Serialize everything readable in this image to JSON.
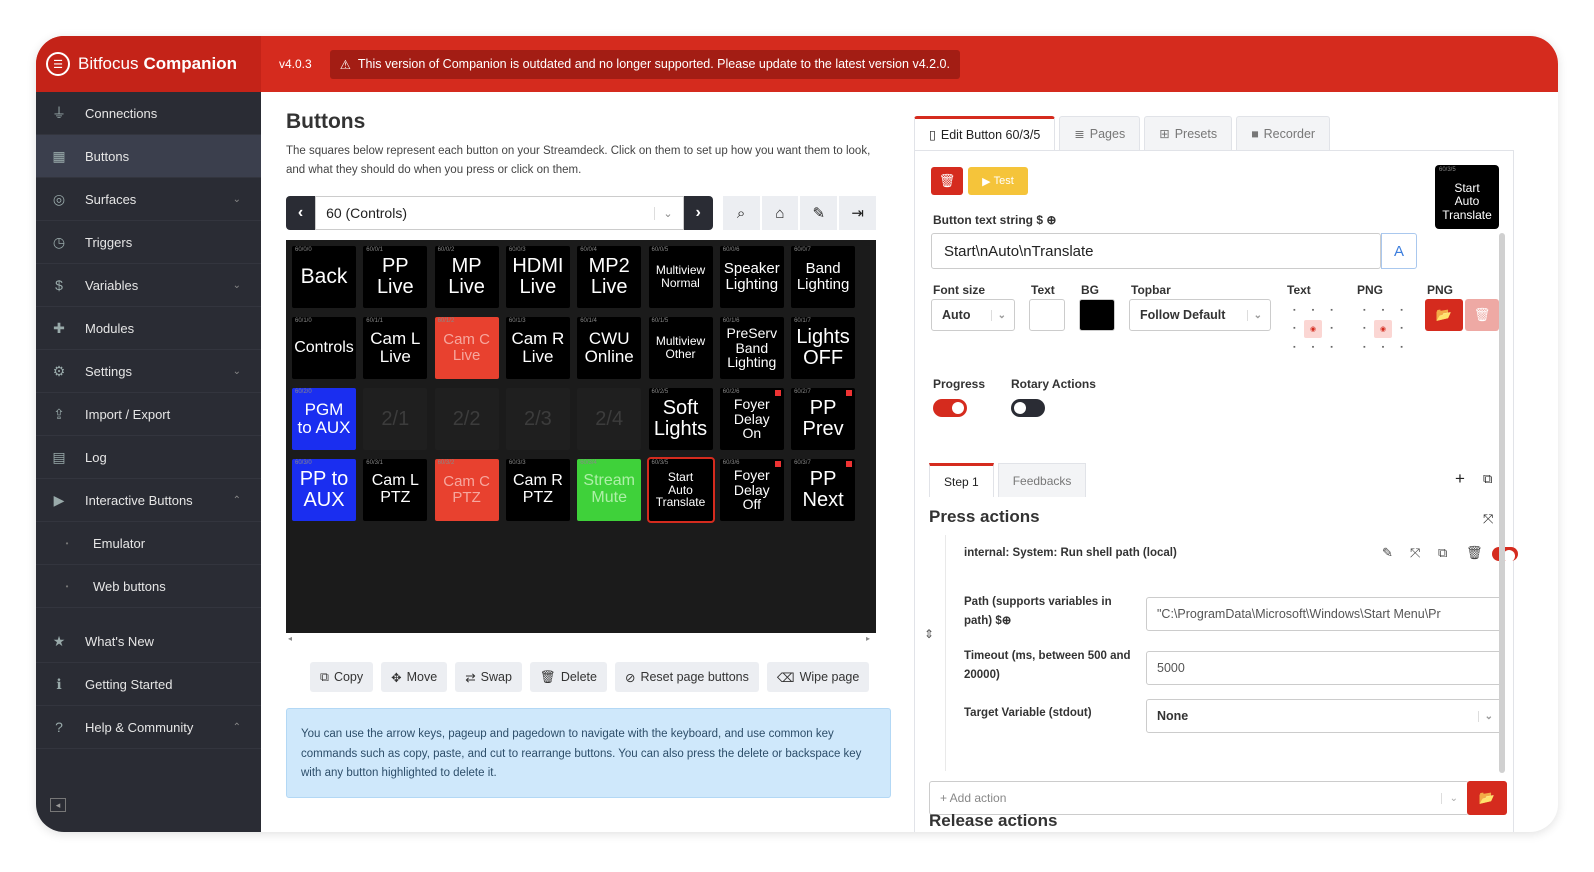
{
  "app": {
    "brand_light": "Bitfocus",
    "brand_bold": "Companion",
    "version": "v4.0.3",
    "alert": "This version of Companion is outdated and no longer supported. Please update to the latest version v4.2.0."
  },
  "sidebar": {
    "items": [
      {
        "label": "Connections",
        "icon": "plug-icon",
        "glyph": "⏚"
      },
      {
        "label": "Buttons",
        "icon": "grid-icon",
        "glyph": "▦"
      },
      {
        "label": "Surfaces",
        "icon": "gamepad-icon",
        "glyph": "◎"
      },
      {
        "label": "Triggers",
        "icon": "clock-icon",
        "glyph": "◷"
      },
      {
        "label": "Variables",
        "icon": "dollar-icon",
        "glyph": "$"
      },
      {
        "label": "Modules",
        "icon": "puzzle-icon",
        "glyph": "✚"
      },
      {
        "label": "Settings",
        "icon": "gear-icon",
        "glyph": "⚙"
      },
      {
        "label": "Import / Export",
        "icon": "file-export-icon",
        "glyph": "⇪"
      },
      {
        "label": "Log",
        "icon": "clipboard-icon",
        "glyph": "▤"
      },
      {
        "label": "Interactive Buttons",
        "icon": "play-square-icon",
        "glyph": "▶"
      },
      {
        "label": "Emulator",
        "icon": "dot-icon",
        "glyph": "•"
      },
      {
        "label": "Web buttons",
        "icon": "dot-icon",
        "glyph": "•"
      },
      {
        "label": "What's New",
        "icon": "star-icon",
        "glyph": "★"
      },
      {
        "label": "Getting Started",
        "icon": "info-icon",
        "glyph": "ℹ"
      },
      {
        "label": "Help & Community",
        "icon": "question-icon",
        "glyph": "?"
      }
    ]
  },
  "main": {
    "title": "Buttons",
    "description": "The squares below represent each button on your Streamdeck. Click on them to set up how you want them to look, and what they should do when you press or click on them.",
    "page_select": "60 (Controls)",
    "actions": [
      "Copy",
      "Move",
      "Swap",
      "Delete",
      "Reset page buttons",
      "Wipe page"
    ],
    "tip": "You can use the arrow keys, pageup and pagedown to navigate with the keyboard, and use common key commands such as copy, paste, and cut to rearrange buttons. You can also press the delete or backspace key with any button highlighted to delete it."
  },
  "grid": {
    "buttons": [
      {
        "id": "60/0/0",
        "text": "Back",
        "size": 21,
        "bg": "#000",
        "fg": "#fff"
      },
      {
        "id": "60/0/1",
        "text": "PP\nLive",
        "size": 20,
        "bg": "#000",
        "fg": "#fff"
      },
      {
        "id": "60/0/2",
        "text": "MP\nLive",
        "size": 20,
        "bg": "#000",
        "fg": "#fff"
      },
      {
        "id": "60/0/3",
        "text": "HDMI\nLive",
        "size": 20,
        "bg": "#000",
        "fg": "#fff"
      },
      {
        "id": "60/0/4",
        "text": "MP2\nLive",
        "size": 20,
        "bg": "#000",
        "fg": "#fff"
      },
      {
        "id": "60/0/5",
        "text": "Multiview\nNormal",
        "size": 12,
        "bg": "#000",
        "fg": "#fff"
      },
      {
        "id": "60/0/6",
        "text": "Speaker\nLighting",
        "size": 15,
        "bg": "#000",
        "fg": "#fff"
      },
      {
        "id": "60/0/7",
        "text": "Band\nLighting",
        "size": 15,
        "bg": "#000",
        "fg": "#fff"
      },
      {
        "id": "60/1/0",
        "text": "Controls",
        "size": 16,
        "bg": "#000",
        "fg": "#fff"
      },
      {
        "id": "60/1/1",
        "text": "Cam L\nLive",
        "size": 17,
        "bg": "#000",
        "fg": "#fff"
      },
      {
        "id": "60/1/2",
        "text": "Cam C\nLive",
        "size": 15,
        "bg": "#e8412f",
        "fg": "#f6a79e"
      },
      {
        "id": "60/1/3",
        "text": "Cam R\nLive",
        "size": 17,
        "bg": "#000",
        "fg": "#fff"
      },
      {
        "id": "60/1/4",
        "text": "CWU\nOnline",
        "size": 17,
        "bg": "#000",
        "fg": "#fff"
      },
      {
        "id": "60/1/5",
        "text": "Multiview\nOther",
        "size": 12,
        "bg": "#000",
        "fg": "#fff"
      },
      {
        "id": "60/1/6",
        "text": "PreServ\nBand\nLighting",
        "size": 14,
        "bg": "#000",
        "fg": "#fff"
      },
      {
        "id": "60/1/7",
        "text": "Lights\nOFF",
        "size": 20,
        "bg": "#000",
        "fg": "#fff"
      },
      {
        "id": "60/2/0",
        "text": "PGM\nto AUX",
        "size": 17,
        "bg": "#1a2ef0",
        "fg": "#fff"
      },
      {
        "id": "",
        "text": "2/1",
        "size": 20,
        "bg": "empty",
        "fg": ""
      },
      {
        "id": "",
        "text": "2/2",
        "size": 20,
        "bg": "empty",
        "fg": ""
      },
      {
        "id": "",
        "text": "2/3",
        "size": 20,
        "bg": "empty",
        "fg": ""
      },
      {
        "id": "",
        "text": "2/4",
        "size": 20,
        "bg": "empty",
        "fg": ""
      },
      {
        "id": "60/2/5",
        "text": "Soft\nLights",
        "size": 20,
        "bg": "#000",
        "fg": "#fff"
      },
      {
        "id": "60/2/6",
        "text": "Foyer\nDelay\nOn",
        "size": 14,
        "bg": "#000",
        "fg": "#fff",
        "dot": true
      },
      {
        "id": "60/2/7",
        "text": "PP\nPrev",
        "size": 20,
        "bg": "#000",
        "fg": "#fff",
        "dot": true
      },
      {
        "id": "60/3/0",
        "text": "PP to\nAUX",
        "size": 20,
        "bg": "#1a2ef0",
        "fg": "#fff"
      },
      {
        "id": "60/3/1",
        "text": "Cam L\nPTZ",
        "size": 16,
        "bg": "#000",
        "fg": "#fff"
      },
      {
        "id": "60/3/2",
        "text": "Cam C\nPTZ",
        "size": 15,
        "bg": "#e8412f",
        "fg": "#f6a79e"
      },
      {
        "id": "60/3/3",
        "text": "Cam R\nPTZ",
        "size": 16,
        "bg": "#000",
        "fg": "#fff"
      },
      {
        "id": "60/3/4",
        "text": "Stream\nMute",
        "size": 16,
        "bg": "#3fd13a",
        "fg": "#aef0a8"
      },
      {
        "id": "60/3/5",
        "text": "Start\nAuto\nTranslate",
        "size": 12,
        "bg": "#000",
        "fg": "#fff",
        "selected": true
      },
      {
        "id": "60/3/6",
        "text": "Foyer\nDelay\nOff",
        "size": 14,
        "bg": "#000",
        "fg": "#fff",
        "dot": true
      },
      {
        "id": "60/3/7",
        "text": "PP\nNext",
        "size": 20,
        "bg": "#000",
        "fg": "#fff",
        "dot": true
      }
    ]
  },
  "editor": {
    "tabs": [
      "Edit Button 60/3/5",
      "Pages",
      "Presets",
      "Recorder"
    ],
    "test_label": "Test",
    "preview_text": "Start\nAuto\nTranslate",
    "preview_id": "60/3/5",
    "text_string_label": "Button text string",
    "text_string_value": "Start\\nAuto\\nTranslate",
    "font_size_label": "Font size",
    "font_size_value": "Auto",
    "text_label": "Text",
    "bg_label": "BG",
    "topbar_label": "Topbar",
    "topbar_value": "Follow Default",
    "text_align_label": "Text",
    "png_align_label": "PNG",
    "png_label": "PNG",
    "text_color": "#ffffff",
    "bg_color": "#000000",
    "progress_label": "Progress",
    "rotary_label": "Rotary Actions",
    "steps": [
      "Step 1",
      "Feedbacks"
    ],
    "press_actions": "Press actions",
    "action_title": "internal: System: Run shell path (local)",
    "path_label": "Path (supports variables in path)",
    "path_value": "\"C:\\ProgramData\\Microsoft\\Windows\\Start Menu\\Pr",
    "timeout_label": "Timeout (ms, between 500 and 20000)",
    "timeout_value": "5000",
    "target_label": "Target Variable (stdout)",
    "target_value": "None",
    "add_action": "+ Add action",
    "release_actions": "Release actions"
  },
  "colors": {
    "accent": "#d52b1e",
    "sidebar": "#2a2c34",
    "tip_bg": "#cfe8fb"
  }
}
